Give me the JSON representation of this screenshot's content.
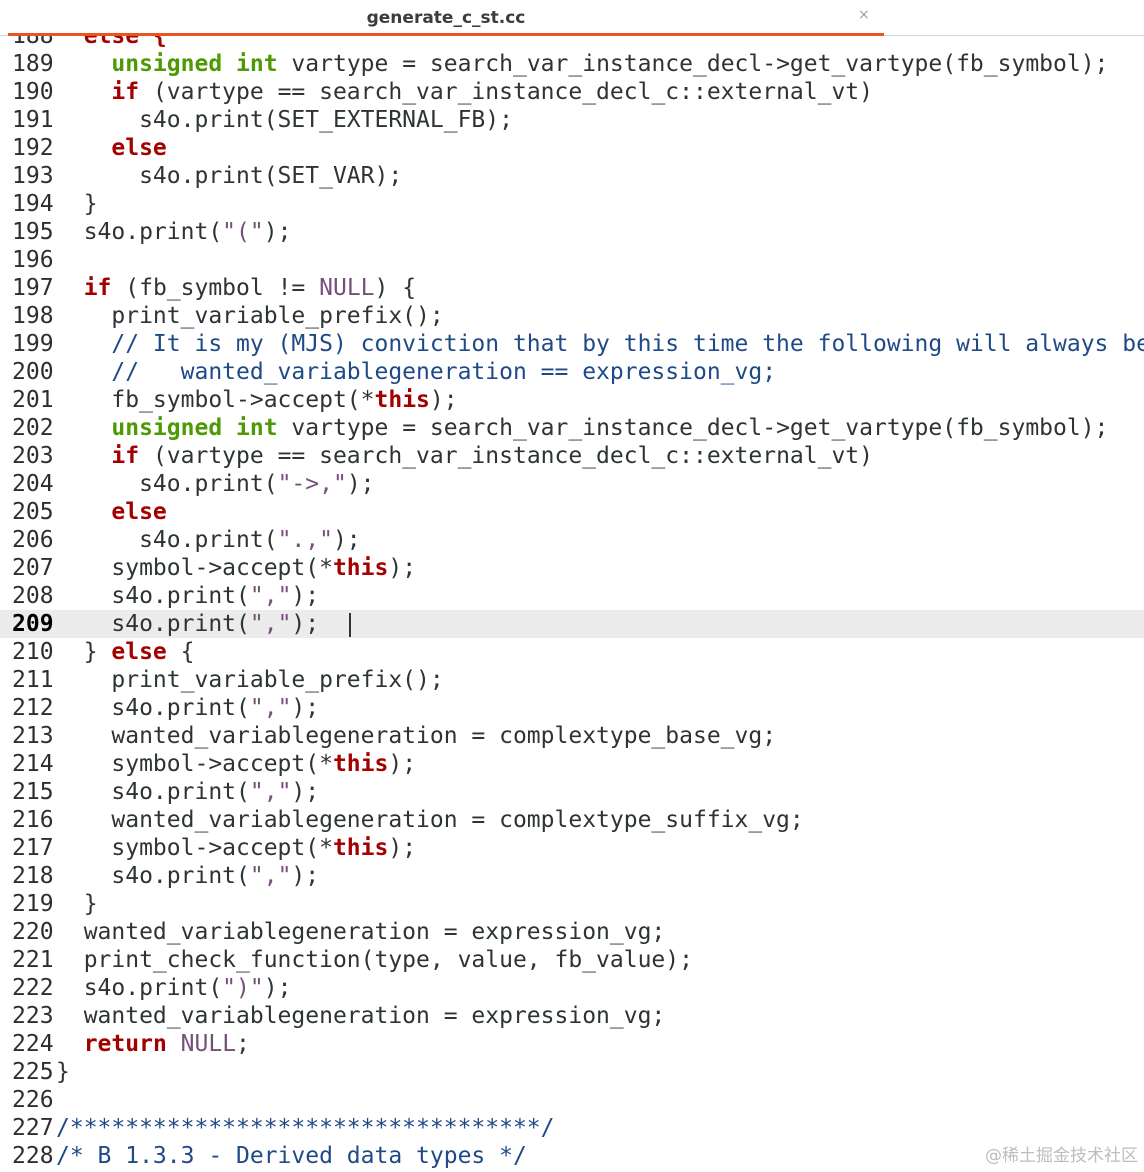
{
  "tab": {
    "title": "generate_c_st.cc",
    "close_glyph": "×"
  },
  "watermark": "@稀土掘金技术社区",
  "current_line": "209",
  "lines": [
    {
      "n": "188",
      "t": [
        [
          "  ",
          ""
        ],
        [
          "else {",
          "kw"
        ]
      ]
    },
    {
      "n": "189",
      "t": [
        [
          "    ",
          ""
        ],
        [
          "unsigned",
          "ty"
        ],
        [
          " ",
          ""
        ],
        [
          "int",
          "ty"
        ],
        [
          " vartype = search_var_instance_decl->get_vartype(fb_symbol);",
          ""
        ]
      ]
    },
    {
      "n": "190",
      "t": [
        [
          "    ",
          ""
        ],
        [
          "if",
          "kw"
        ],
        [
          " (vartype == search_var_instance_decl_c::external_vt)",
          ""
        ]
      ]
    },
    {
      "n": "191",
      "t": [
        [
          "      s4o.print(SET_EXTERNAL_FB);",
          ""
        ]
      ]
    },
    {
      "n": "192",
      "t": [
        [
          "    ",
          ""
        ],
        [
          "else",
          "kw"
        ]
      ]
    },
    {
      "n": "193",
      "t": [
        [
          "      s4o.print(SET_VAR);",
          ""
        ]
      ]
    },
    {
      "n": "194",
      "t": [
        [
          "  }",
          ""
        ]
      ]
    },
    {
      "n": "195",
      "t": [
        [
          "  s4o.print(",
          ""
        ],
        [
          "\"(\"",
          "str"
        ],
        [
          ");",
          ""
        ]
      ]
    },
    {
      "n": "196",
      "t": []
    },
    {
      "n": "197",
      "t": [
        [
          "  ",
          ""
        ],
        [
          "if",
          "kw"
        ],
        [
          " (fb_symbol != ",
          ""
        ],
        [
          "NULL",
          "str"
        ],
        [
          ") {",
          ""
        ]
      ]
    },
    {
      "n": "198",
      "t": [
        [
          "    print_variable_prefix();",
          ""
        ]
      ]
    },
    {
      "n": "199",
      "t": [
        [
          "    ",
          ""
        ],
        [
          "// It is my (MJS) conviction that by this time the following will always be true...",
          "cm"
        ]
      ]
    },
    {
      "n": "200",
      "t": [
        [
          "    ",
          ""
        ],
        [
          "//   wanted_variablegeneration == expression_vg;",
          "cm"
        ]
      ]
    },
    {
      "n": "201",
      "t": [
        [
          "    fb_symbol->accept(*",
          ""
        ],
        [
          "this",
          "kw"
        ],
        [
          ");",
          ""
        ]
      ]
    },
    {
      "n": "202",
      "t": [
        [
          "    ",
          ""
        ],
        [
          "unsigned",
          "ty"
        ],
        [
          " ",
          ""
        ],
        [
          "int",
          "ty"
        ],
        [
          " vartype = search_var_instance_decl->get_vartype(fb_symbol);",
          ""
        ]
      ]
    },
    {
      "n": "203",
      "t": [
        [
          "    ",
          ""
        ],
        [
          "if",
          "kw"
        ],
        [
          " (vartype == search_var_instance_decl_c::external_vt)",
          ""
        ]
      ]
    },
    {
      "n": "204",
      "t": [
        [
          "      s4o.print(",
          ""
        ],
        [
          "\"->,\"",
          "str"
        ],
        [
          ");",
          ""
        ]
      ]
    },
    {
      "n": "205",
      "t": [
        [
          "    ",
          ""
        ],
        [
          "else",
          "kw"
        ]
      ]
    },
    {
      "n": "206",
      "t": [
        [
          "      s4o.print(",
          ""
        ],
        [
          "\".,\"",
          "str"
        ],
        [
          ");",
          ""
        ]
      ]
    },
    {
      "n": "207",
      "t": [
        [
          "    symbol->accept(*",
          ""
        ],
        [
          "this",
          "kw"
        ],
        [
          ");",
          ""
        ]
      ]
    },
    {
      "n": "208",
      "t": [
        [
          "    s4o.print(",
          ""
        ],
        [
          "\",\"",
          "str"
        ],
        [
          ");",
          ""
        ]
      ]
    },
    {
      "n": "209",
      "t": [
        [
          "    s4o.print(",
          ""
        ],
        [
          "\",\"",
          "str"
        ],
        [
          ");  ",
          ""
        ]
      ]
    },
    {
      "n": "210",
      "t": [
        [
          "  } ",
          ""
        ],
        [
          "else",
          "kw"
        ],
        [
          " {",
          ""
        ]
      ]
    },
    {
      "n": "211",
      "t": [
        [
          "    print_variable_prefix();",
          ""
        ]
      ]
    },
    {
      "n": "212",
      "t": [
        [
          "    s4o.print(",
          ""
        ],
        [
          "\",\"",
          "str"
        ],
        [
          ");",
          ""
        ]
      ]
    },
    {
      "n": "213",
      "t": [
        [
          "    wanted_variablegeneration = complextype_base_vg;",
          ""
        ]
      ]
    },
    {
      "n": "214",
      "t": [
        [
          "    symbol->accept(*",
          ""
        ],
        [
          "this",
          "kw"
        ],
        [
          ");",
          ""
        ]
      ]
    },
    {
      "n": "215",
      "t": [
        [
          "    s4o.print(",
          ""
        ],
        [
          "\",\"",
          "str"
        ],
        [
          ");",
          ""
        ]
      ]
    },
    {
      "n": "216",
      "t": [
        [
          "    wanted_variablegeneration = complextype_suffix_vg;",
          ""
        ]
      ]
    },
    {
      "n": "217",
      "t": [
        [
          "    symbol->accept(*",
          ""
        ],
        [
          "this",
          "kw"
        ],
        [
          ");",
          ""
        ]
      ]
    },
    {
      "n": "218",
      "t": [
        [
          "    s4o.print(",
          ""
        ],
        [
          "\",\"",
          "str"
        ],
        [
          ");",
          ""
        ]
      ]
    },
    {
      "n": "219",
      "t": [
        [
          "  }",
          ""
        ]
      ]
    },
    {
      "n": "220",
      "t": [
        [
          "  wanted_variablegeneration = expression_vg;",
          ""
        ]
      ]
    },
    {
      "n": "221",
      "t": [
        [
          "  print_check_function(type, value, fb_value);",
          ""
        ]
      ]
    },
    {
      "n": "222",
      "t": [
        [
          "  s4o.print(",
          ""
        ],
        [
          "\")\"",
          "str"
        ],
        [
          ");",
          ""
        ]
      ]
    },
    {
      "n": "223",
      "t": [
        [
          "  wanted_variablegeneration = expression_vg;",
          ""
        ]
      ]
    },
    {
      "n": "224",
      "t": [
        [
          "  ",
          ""
        ],
        [
          "return",
          "kw"
        ],
        [
          " ",
          ""
        ],
        [
          "NULL",
          "str"
        ],
        [
          ";",
          ""
        ]
      ]
    },
    {
      "n": "225",
      "t": [
        [
          "}",
          ""
        ]
      ]
    },
    {
      "n": "226",
      "t": []
    },
    {
      "n": "227",
      "t": [
        [
          "/**********************************/",
          "cm"
        ]
      ]
    },
    {
      "n": "228",
      "t": [
        [
          "/* B 1.3.3 - Derived data types */",
          "cm"
        ]
      ]
    }
  ]
}
